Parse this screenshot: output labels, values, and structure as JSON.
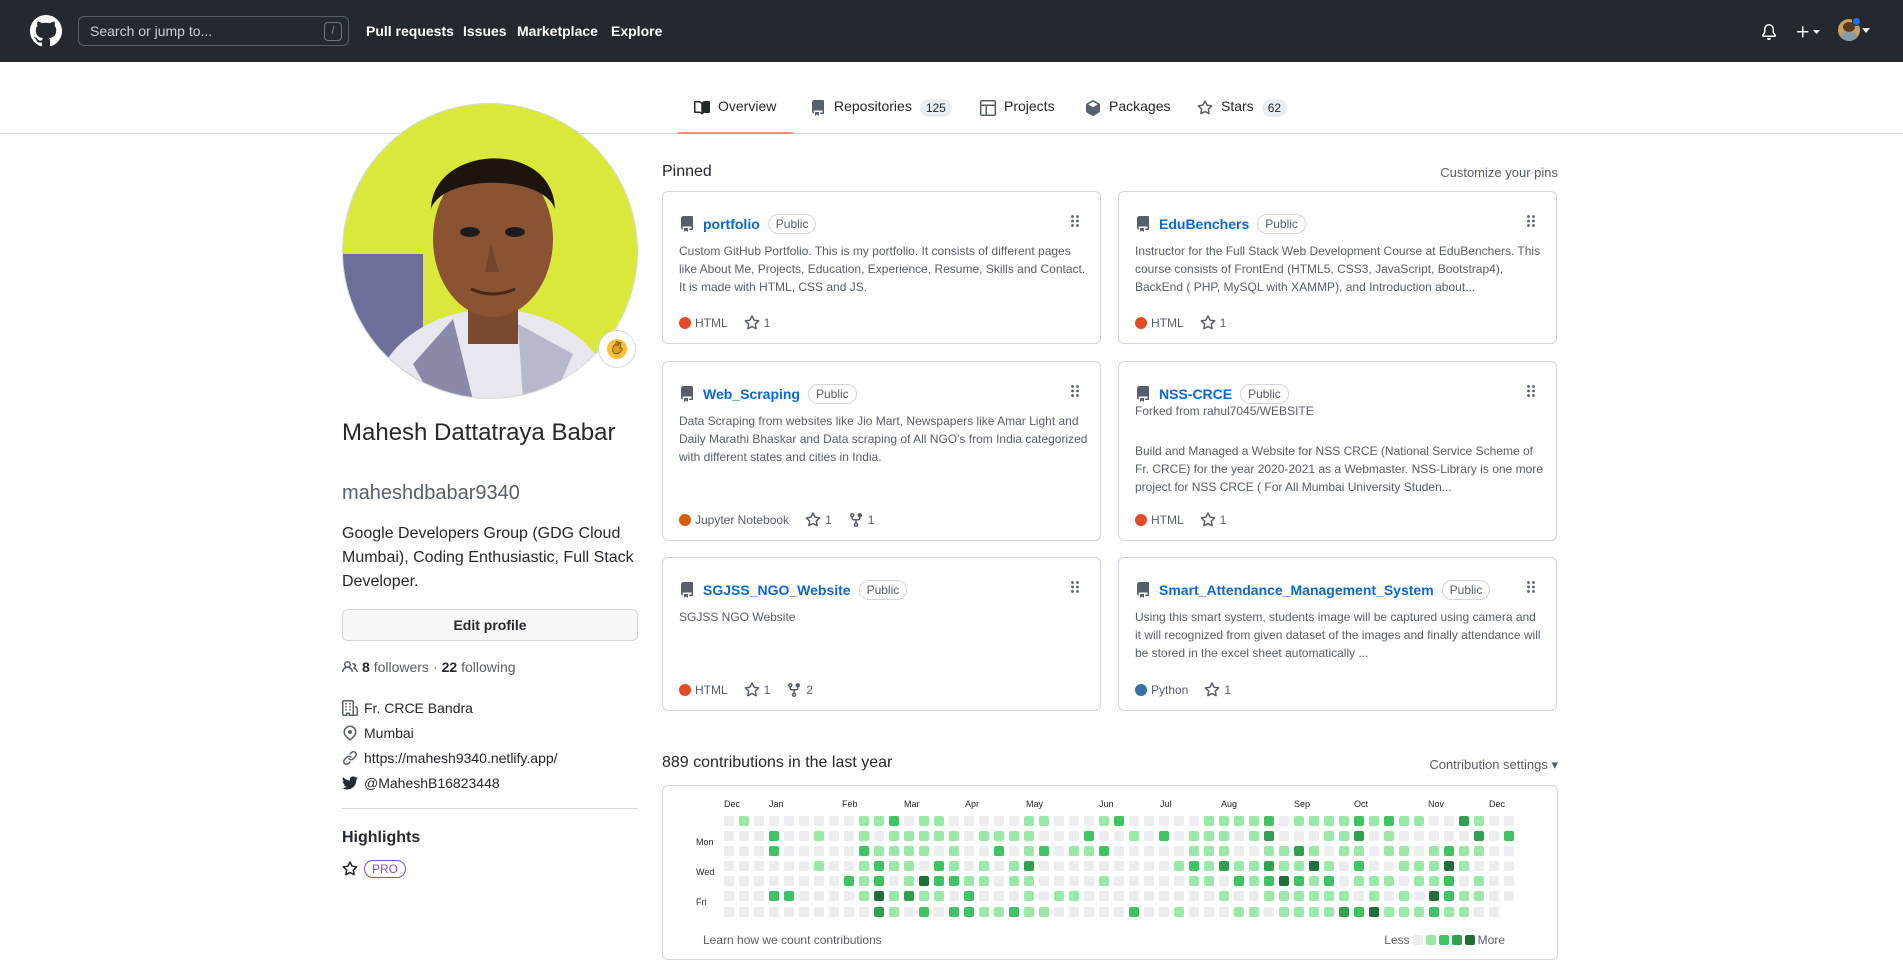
{
  "header": {
    "search_placeholder": "Search or jump to...",
    "search_shortcut": "/",
    "nav": [
      "Pull requests",
      "Issues",
      "Marketplace",
      "Explore"
    ]
  },
  "tabs": [
    {
      "label": "Overview",
      "icon": "book-icon",
      "count": ""
    },
    {
      "label": "Repositories",
      "icon": "repo-icon",
      "count": "125"
    },
    {
      "label": "Projects",
      "icon": "project-icon",
      "count": ""
    },
    {
      "label": "Packages",
      "icon": "package-icon",
      "count": ""
    },
    {
      "label": "Stars",
      "icon": "star-icon",
      "count": "62"
    }
  ],
  "profile": {
    "full_name": "Mahesh Dattatraya Babar",
    "login": "maheshdbabar9340",
    "bio": "Google Developers Group (GDG Cloud Mumbai), Coding Enthusiastic, Full Stack Developer.",
    "edit_label": "Edit profile",
    "followers_count": "8",
    "followers_label": "followers",
    "following_sep": "·",
    "following_count": "22",
    "following_label": "following",
    "organization": "Fr. CRCE Bandra",
    "location": "Mumbai",
    "website": "https://mahesh9340.netlify.app/",
    "twitter": "@MaheshB16823448",
    "highlights_title": "Highlights",
    "pro_label": "PRO"
  },
  "pinned": {
    "title": "Pinned",
    "customize": "Customize your pins",
    "repos": [
      {
        "name": "portfolio",
        "visibility": "Public",
        "forked_from": "",
        "description": "Custom GitHub Portfolio. This is my portfolio. It consists of different pages like About Me, Projects, Education, Experience, Resume, Skills and Contact. It is made with HTML, CSS and JS.",
        "language": "HTML",
        "lang_color": "#e34c26",
        "stars": "1",
        "forks": ""
      },
      {
        "name": "EduBenchers",
        "visibility": "Public",
        "forked_from": "",
        "description": "Instructor for the Full Stack Web Development Course at EduBenchers. This course consists of FrontEnd (HTML5, CSS3, JavaScript, Bootstrap4), BackEnd ( PHP, MySQL with XAMMP), and Introduction about...",
        "language": "HTML",
        "lang_color": "#e34c26",
        "stars": "1",
        "forks": ""
      },
      {
        "name": "Web_Scraping",
        "visibility": "Public",
        "forked_from": "",
        "description": "Data Scraping from websites like Jio Mart, Newspapers like Amar Light and Daily Marathi Bhaskar and Data scraping of All NGO's from India categorized with different states and cities in India.",
        "language": "Jupyter Notebook",
        "lang_color": "#DA5B0B",
        "stars": "1",
        "forks": "1"
      },
      {
        "name": "NSS-CRCE",
        "visibility": "Public",
        "forked_from": "Forked from rahul7045/WEBSITE",
        "description": "Build and Managed a Website for NSS CRCE (National Service Scheme of Fr. CRCE) for the year 2020-2021 as a Webmaster. NSS-Library is one more project for NSS CRCE ( For All Mumbai University Studen...",
        "language": "HTML",
        "lang_color": "#e34c26",
        "stars": "1",
        "forks": ""
      },
      {
        "name": "SGJSS_NGO_Website",
        "visibility": "Public",
        "forked_from": "",
        "description": "SGJSS NGO Website",
        "language": "HTML",
        "lang_color": "#e34c26",
        "stars": "1",
        "forks": "2"
      },
      {
        "name": "Smart_Attendance_Management_System",
        "visibility": "Public",
        "forked_from": "",
        "description": "Using this smart system, students image will be captured using camera and it will recognized from given dataset of the images and finally attendance will be stored in the excel sheet automatically ...",
        "language": "Python",
        "lang_color": "#3572A5",
        "stars": "1",
        "forks": ""
      }
    ]
  },
  "contributions": {
    "title": "889 contributions in the last year",
    "settings": "Contribution settings",
    "months": [
      "Dec",
      "Jan",
      "Feb",
      "Mar",
      "Apr",
      "May",
      "Jun",
      "Jul",
      "Aug",
      "Sep",
      "Oct",
      "Nov",
      "Dec"
    ],
    "weekdays": [
      "Mon",
      "Wed",
      "Fri"
    ],
    "learn": "Learn how we count contributions",
    "less": "Less",
    "more": "More",
    "colors": [
      "#ebedf0",
      "#9be9a8",
      "#40c463",
      "#30a14e",
      "#216e39"
    ]
  }
}
